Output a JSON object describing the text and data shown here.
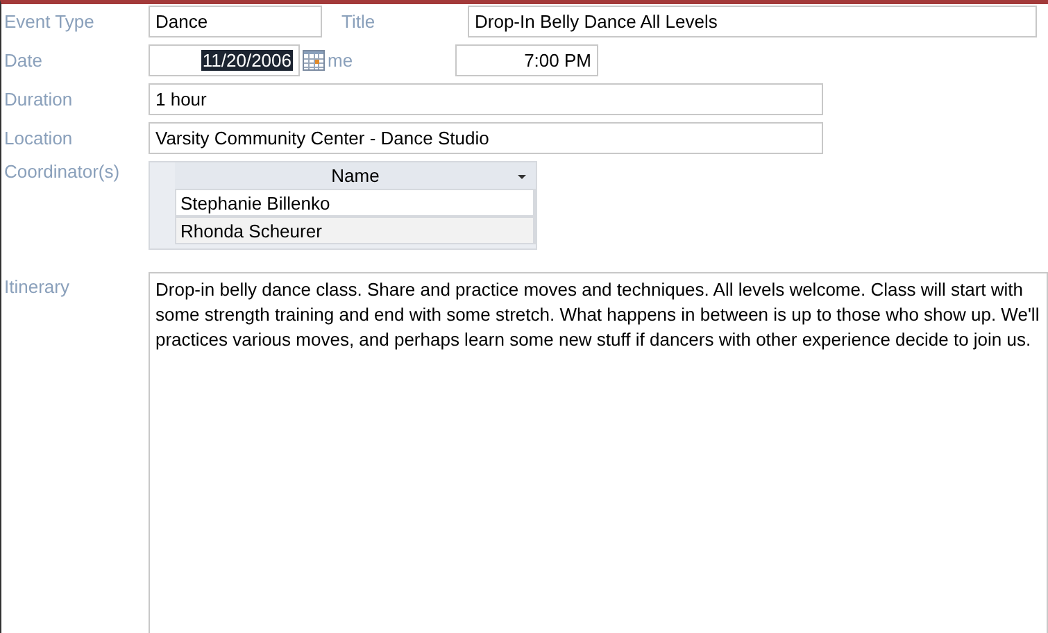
{
  "fields": {
    "event_type": {
      "label": "Event Type",
      "value": "Dance"
    },
    "title": {
      "label": "Title",
      "value": "Drop-In Belly Dance All Levels"
    },
    "date": {
      "label": "Date",
      "value": "11/20/2006",
      "text_selected": true
    },
    "time": {
      "label": "me",
      "value": "7:00 PM"
    },
    "duration": {
      "label": "Duration",
      "value": "1 hour"
    },
    "location": {
      "label": "Location",
      "value": "Varsity Community Center - Dance Studio"
    }
  },
  "coordinators": {
    "label": "Coordinator(s)",
    "column": "Name",
    "rows": [
      {
        "name": "Stephanie Billenko",
        "selected": true
      },
      {
        "name": "Rhonda Scheurer",
        "selected": false
      }
    ]
  },
  "itinerary": {
    "label": "Itinerary",
    "value": "Drop-in belly dance class.  Share and practice moves and techniques.  All levels welcome.  Class will start with some strength training and end with some stretch.  What happens in between is up to those who show up.  We'll practices various moves, and perhaps learn some new stuff if dancers with other experience decide to join us."
  }
}
